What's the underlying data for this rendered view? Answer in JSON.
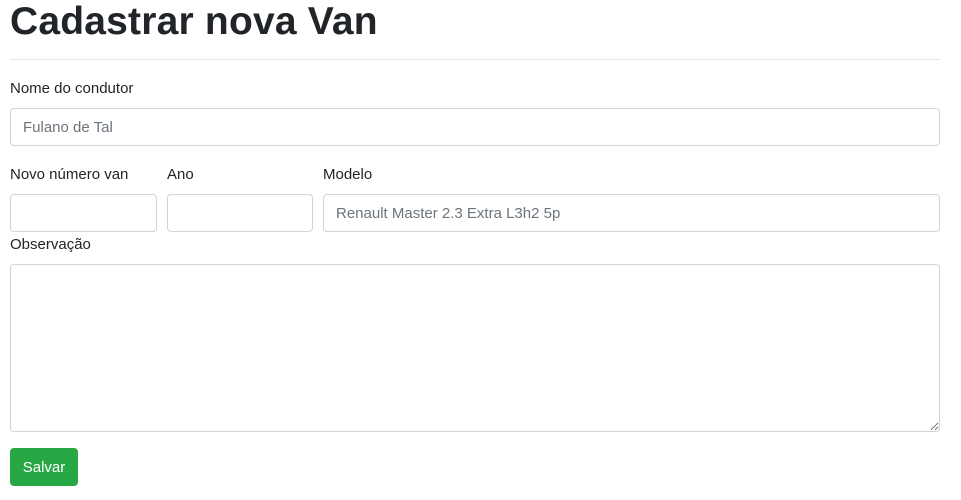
{
  "page": {
    "title": "Cadastrar nova Van"
  },
  "form": {
    "driver_name": {
      "label": "Nome do condutor",
      "placeholder": "Fulano de Tal",
      "value": ""
    },
    "van_number": {
      "label": "Novo número van",
      "placeholder": "",
      "value": ""
    },
    "year": {
      "label": "Ano",
      "placeholder": "",
      "value": ""
    },
    "model": {
      "label": "Modelo",
      "placeholder": "Renault Master 2.3 Extra L3h2 5p",
      "value": ""
    },
    "notes": {
      "label": "Observação",
      "value": ""
    },
    "save_label": "Salvar"
  },
  "colors": {
    "save_button": "#28a745",
    "input_border": "#ced4da",
    "text": "#212529"
  }
}
